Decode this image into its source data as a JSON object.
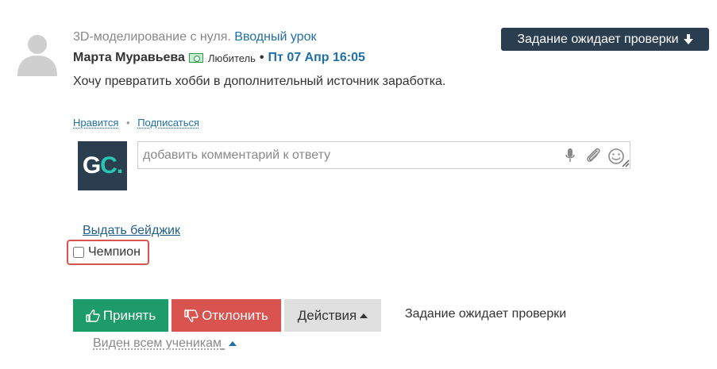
{
  "post": {
    "lesson_prefix": "3D-моделирование с нуля.",
    "lesson_link": "Вводный урок",
    "author": "Марта Муравьева",
    "level": "Любитель",
    "separator": "•",
    "date": "Пт 07 Апр 16:05",
    "status_pill": "Задание ожидает проверки",
    "answer_text": "Хочу превратить хобби в дополнительный источник заработка."
  },
  "reactions": {
    "like": "Нравится",
    "separator": "•",
    "subscribe": "Подписаться"
  },
  "comment": {
    "placeholder": "добавить комментарий к ответу",
    "logo_left": "G",
    "logo_right": "C."
  },
  "badge": {
    "link": "Выдать бейджик",
    "option": "Чемпион",
    "checked": false
  },
  "buttons": {
    "accept": "Принять",
    "reject": "Отклонить",
    "actions": "Действия"
  },
  "status_text": "Задание ожидает проверки",
  "visibility": "Виден всем ученикам",
  "colors": {
    "link": "#1f6fa8",
    "pill_bg": "#2b3e50",
    "accept": "#1e9b6a",
    "reject": "#d9534f",
    "logo_accent": "#26c6b0"
  },
  "icons": [
    "user-placeholder-icon",
    "money-icon",
    "arrow-down-icon",
    "microphone-icon",
    "paperclip-icon",
    "smiley-icon",
    "resize-handle-icon",
    "thumbs-up-icon",
    "thumbs-down-icon",
    "caret-up-icon"
  ]
}
